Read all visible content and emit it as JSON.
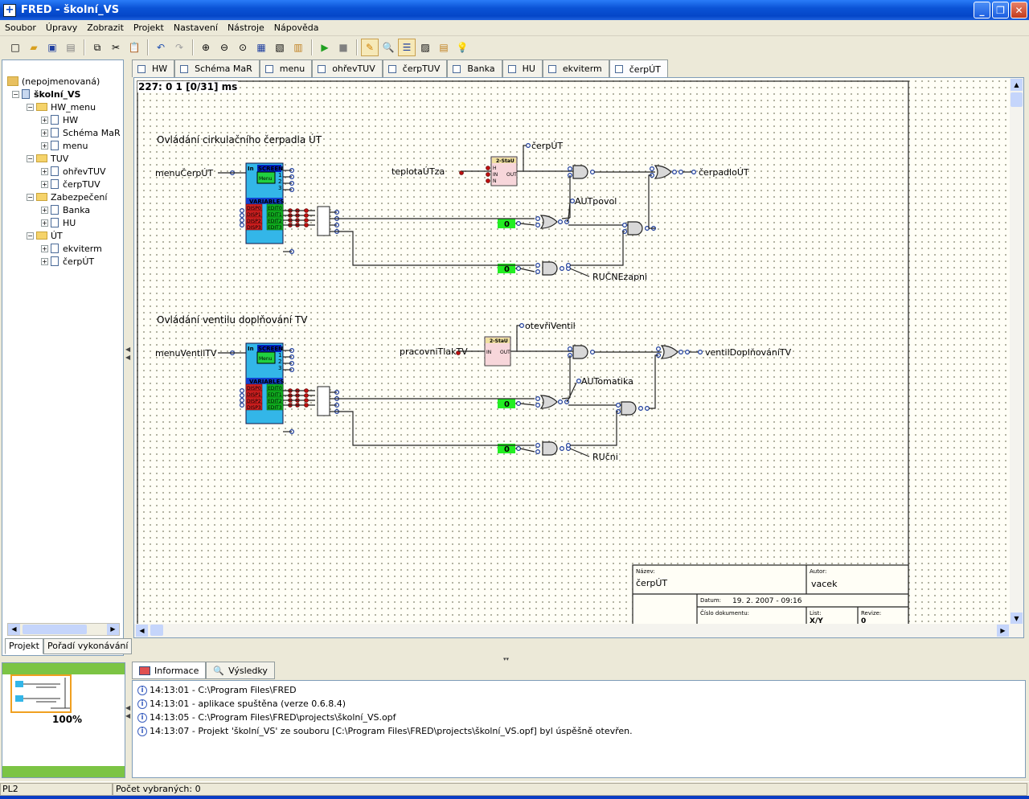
{
  "window": {
    "title": "FRED - školní_VS",
    "icon": "app-icon",
    "controls": [
      "minimize",
      "maximize",
      "close"
    ]
  },
  "menu": [
    "Soubor",
    "Úpravy",
    "Zobrazit",
    "Projekt",
    "Nastavení",
    "Nástroje",
    "Nápověda"
  ],
  "toolbar": [
    "new",
    "open",
    "save",
    "save-all",
    "copy",
    "cut",
    "paste",
    "undo",
    "redo",
    "zoom-in",
    "zoom-out",
    "zoom-fit",
    "page",
    "page-preview",
    "page-clip",
    "run",
    "stop",
    "pin",
    "find",
    "list",
    "view",
    "list2",
    "bulb"
  ],
  "tree": {
    "root": "(nepojmenovaná)",
    "project": "školní_VS",
    "items": [
      {
        "label": "HW_menu",
        "level": 1,
        "type": "folder"
      },
      {
        "label": "HW",
        "level": 2,
        "type": "page"
      },
      {
        "label": "Schéma MaR",
        "level": 2,
        "type": "page"
      },
      {
        "label": "menu",
        "level": 2,
        "type": "page"
      },
      {
        "label": "TUV",
        "level": 1,
        "type": "folder"
      },
      {
        "label": "ohřevTUV",
        "level": 2,
        "type": "page"
      },
      {
        "label": "čerpTUV",
        "level": 2,
        "type": "page"
      },
      {
        "label": "Zabezpečení",
        "level": 1,
        "type": "folder"
      },
      {
        "label": "Banka",
        "level": 2,
        "type": "page"
      },
      {
        "label": "HU",
        "level": 2,
        "type": "page"
      },
      {
        "label": "ÚT",
        "level": 1,
        "type": "folder"
      },
      {
        "label": "ekviterm",
        "level": 2,
        "type": "page"
      },
      {
        "label": "čerpÚT",
        "level": 2,
        "type": "page"
      }
    ]
  },
  "left_tabs": [
    "Projekt",
    "Pořadí vykonávání"
  ],
  "doc_tabs": [
    "HW",
    "Schéma MaR",
    "menu",
    "ohřevTUV",
    "čerpTUV",
    "Banka",
    "HU",
    "ekviterm",
    "čerpÚT"
  ],
  "active_doc_tab": "čerpÚT",
  "canvas": {
    "cycle": "227: 0 1 [0/31] ms",
    "section1": {
      "title": "Ovládání cirkulačního čerpadla ÚT",
      "input_menu": "menuČerpÚT",
      "input_temp": "teplotaÚTza",
      "block": "2-StaU",
      "block_pins": [
        "H",
        "IN",
        "N"
      ],
      "block_out": "OUT",
      "out_top": "čerpÚT",
      "out_main": "čerpadloÚT",
      "label_a": "AUTpovol",
      "label_b": "RUČNEzapni",
      "const1": "0",
      "const2": "0"
    },
    "section2": {
      "title": "Ovládání ventilu doplňování TV",
      "input_menu": "menuVentilTV",
      "input_press": "pracovniTlakTV",
      "block": "2-StaU",
      "block_in": "IN",
      "block_out": "OUT",
      "out_top": "otevřiVentil",
      "out_main": "ventilDoplňováníTV",
      "label_a": "AUTomatika",
      "label_b": "RUčni",
      "const1": "0",
      "const2": "0"
    },
    "screen_block": {
      "in": "In",
      "screen": "SCREEN",
      "menu": "Menu",
      "outs": [
        "1",
        "2",
        "3"
      ],
      "variables": "VARIABLES",
      "disp": [
        "DISP0",
        "DISP1",
        "DISP2",
        "DISP3"
      ],
      "edit": [
        "EDIT0",
        "EDIT1",
        "EDIT2",
        "EDIT3"
      ]
    },
    "title_block": {
      "nazev_label": "Název:",
      "nazev": "čerpÚT",
      "autor_label": "Autor:",
      "autor": "vacek",
      "datum_label": "Datum:",
      "datum": "19. 2. 2007 - 09:16",
      "cislo_label": "Číslo dokumentu:",
      "list_label": "List:",
      "list": "X/Y",
      "revize_label": "Revize:",
      "revize": "0"
    }
  },
  "info_tabs": [
    "Informace",
    "Výsledky"
  ],
  "info_lines": [
    "14:13:01 - C:\\Program Files\\FRED",
    "14:13:01 - aplikace spuštěna (verze 0.6.8.4)",
    "14:13:05 - C:\\Program Files\\FRED\\projects\\školní_VS.opf",
    "14:13:07 - Projekt 'školní_VS' ze souboru [C:\\Program Files\\FRED\\projects\\školní_VS.opf] byl úspěšně otevřen."
  ],
  "preview_zoom": "100%",
  "status": {
    "left": "PL2",
    "selected": "Počet vybraných: 0"
  },
  "colors": {
    "titlebar": "#0446c8",
    "screen_block": "#33b6e8",
    "variables_red": "#d02020",
    "edit_green": "#10b020",
    "const_green": "#22ee22",
    "pink_block": "#f7d6da"
  }
}
